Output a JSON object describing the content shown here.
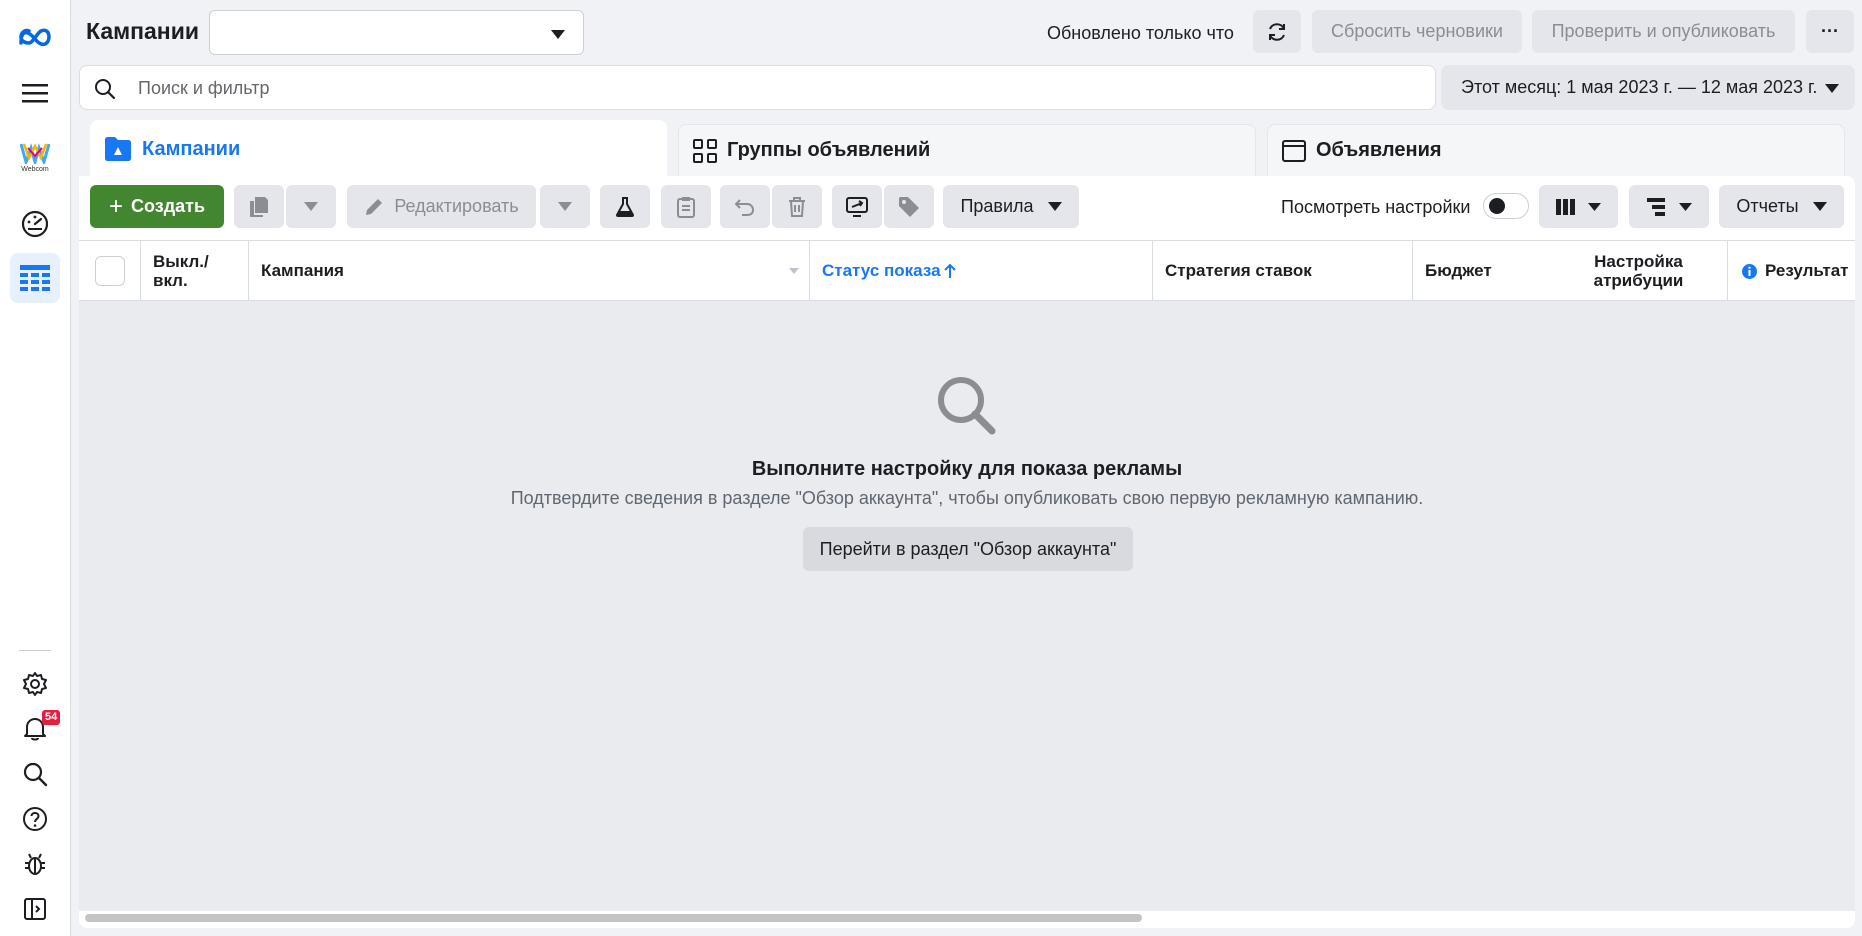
{
  "header": {
    "title": "Кампании",
    "account_value": "",
    "updated_text": "Обновлено только что",
    "reset_drafts_label": "Сбросить черновики",
    "publish_label": "Проверить и опубликовать",
    "more_label": "···"
  },
  "search": {
    "placeholder": "Поиск и фильтр",
    "date_range": "Этот месяц: 1 мая 2023 г. — 12 мая 2023 г."
  },
  "tabs": [
    {
      "label": "Кампании",
      "active": true
    },
    {
      "label": "Группы объявлений",
      "active": false
    },
    {
      "label": "Объявления",
      "active": false
    }
  ],
  "toolbar": {
    "create_label": "Создать",
    "edit_label": "Редактировать",
    "rules_label": "Правила",
    "view_settings_label": "Посмотреть настройки",
    "reports_label": "Отчеты"
  },
  "table": {
    "columns": [
      "Выкл./ вкл.",
      "Кампания",
      "Статус показа",
      "Стратегия ставок",
      "Бюджет",
      "Настройка атрибуции",
      "Результат"
    ],
    "sorted_column": "Статус показа"
  },
  "empty_state": {
    "title": "Выполните настройку для показа рекламы",
    "subtitle": "Подтвердите сведения в разделе \"Обзор аккаунта\", чтобы опубликовать свою первую рекламную кампанию.",
    "button_label": "Перейти в раздел \"Обзор аккаунта\""
  },
  "rail": {
    "logo_text": "Webcom",
    "notification_count": "54"
  },
  "colors": {
    "accent": "#1877f2",
    "create_green": "#42862f",
    "badge_red": "#e41e3f"
  }
}
